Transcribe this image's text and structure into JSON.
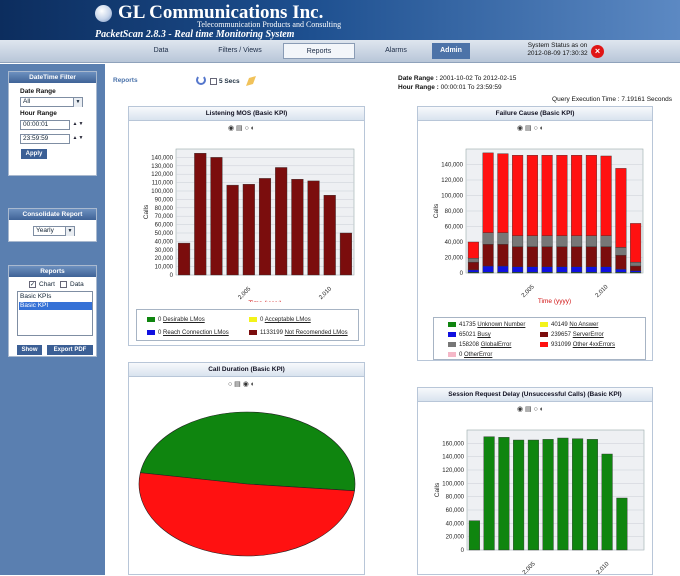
{
  "header": {
    "company": "GL Communications Inc.",
    "tagline": "Telecommunication Products and Consulting",
    "product": "PacketScan 2.8.3 - Real time Monitoring System"
  },
  "nav": {
    "items": [
      {
        "label": "Data"
      },
      {
        "label": "Filters / Views"
      },
      {
        "label": "Reports",
        "active": true
      },
      {
        "label": "Alarms"
      },
      {
        "label": "Admin",
        "admin": true
      }
    ],
    "status_label": "System Status as on",
    "status_time": "2012-08-09 17:30:32"
  },
  "sidebar": {
    "datetime_filter": {
      "title": "DateTime Filter",
      "date_range_label": "Date Range",
      "date_range_value": "All",
      "hour_range_label": "Hour Range",
      "hour_start": "00:00:01",
      "hour_end": "23:59:59",
      "apply_label": "Apply"
    },
    "consolidate": {
      "title": "Consolidate Report",
      "value": "Yearly"
    },
    "reports": {
      "title": "Reports",
      "chart_label": "Chart",
      "data_label": "Data",
      "items": [
        "Basic KPIs",
        "Basic KPI"
      ],
      "show_label": "Show",
      "export_label": "Export PDF"
    }
  },
  "toolbar": {
    "reports_label": "Reports",
    "refresh_label": "5 Secs",
    "date_range_label": "Date Range :",
    "date_range_value": "2001-10-02 To 2012-02-15",
    "hour_range_label": "Hour Range :",
    "hour_range_value": "00:00:01 To 23:59:59",
    "query_time": "Query Execution Time : 7.19161 Seconds"
  },
  "colors": {
    "maroon": "#7b0d0d",
    "red": "#ff1111",
    "grey": "#777777",
    "blue": "#1010e0",
    "green": "#0f850f",
    "yellow": "#f3f31a"
  },
  "chart_data": [
    {
      "type": "bar",
      "title": "Listening MOS (Basic KPI)",
      "xlabel": "Time (yyyy)",
      "ylabel": "Calls",
      "ylim": [
        0,
        150000
      ],
      "yticks": [
        0,
        10000,
        20000,
        30000,
        40000,
        50000,
        60000,
        70000,
        80000,
        90000,
        100000,
        110000,
        120000,
        130000,
        140000
      ],
      "ytick_labels": [
        "0",
        "10,000",
        "20,000",
        "30,000",
        "40,000",
        "50,000",
        "60,000",
        "70,000",
        "80,000",
        "90,000",
        "100,000",
        "110,000",
        "120,000",
        "130,000",
        "140,000"
      ],
      "x": [
        2001,
        2002,
        2003,
        2004,
        2005,
        2006,
        2007,
        2008,
        2009,
        2010,
        2011
      ],
      "xtick_labels": [
        "2,005",
        "2,010"
      ],
      "xtick_values": [
        2005,
        2010
      ],
      "series": [
        {
          "values": [
            38000,
            145000,
            140000,
            107000,
            108000,
            115000,
            128000,
            114000,
            112000,
            95000,
            50000
          ]
        }
      ],
      "legend": [
        {
          "value": "0",
          "label": "Desirable LMos",
          "color": "#0f850f"
        },
        {
          "value": "0",
          "label": "Acceptable LMos",
          "color": "#f3f31a"
        },
        {
          "value": "0",
          "label": "Reach Connection LMos",
          "color": "#1010e0"
        },
        {
          "value": "1133199",
          "label": "Not Recomended LMos",
          "color": "#7b0d0d"
        }
      ]
    },
    {
      "type": "bar",
      "title": "Failure Cause (Basic KPI)",
      "xlabel": "Time (yyyy)",
      "ylabel": "Calls",
      "ylim": [
        0,
        160000
      ],
      "yticks": [
        0,
        20000,
        40000,
        60000,
        80000,
        100000,
        120000,
        140000
      ],
      "ytick_labels": [
        "0",
        "20,000",
        "40,000",
        "60,000",
        "80,000",
        "100,000",
        "120,000",
        "140,000"
      ],
      "x": [
        2001,
        2002,
        2003,
        2004,
        2005,
        2006,
        2007,
        2008,
        2009,
        2010,
        2011,
        2012
      ],
      "xtick_labels": [
        "2,005",
        "2,010"
      ],
      "xtick_values": [
        2005,
        2010
      ],
      "series": [
        {
          "name": "Unknown Number",
          "color": "#0f850f",
          "values": [
            1000,
            1000,
            1000,
            1000,
            1000,
            1000,
            1000,
            1000,
            1000,
            1000,
            1000,
            1000
          ]
        },
        {
          "name": "Busy",
          "color": "#1010e0",
          "values": [
            3000,
            8000,
            8000,
            7000,
            7000,
            7000,
            7000,
            7000,
            7000,
            7000,
            4000,
            2000
          ]
        },
        {
          "name": "ServerError",
          "color": "#7b0d0d",
          "values": [
            10000,
            28000,
            28000,
            26000,
            26000,
            26000,
            26000,
            26000,
            26000,
            26000,
            18000,
            6000
          ]
        },
        {
          "name": "GlobalError",
          "color": "#777777",
          "values": [
            5000,
            15000,
            15000,
            14000,
            14000,
            14000,
            14000,
            14000,
            14000,
            14000,
            10000,
            5000
          ]
        },
        {
          "name": "Other 4xxErrors",
          "color": "#ff1111",
          "values": [
            21000,
            103000,
            102000,
            104000,
            104000,
            104000,
            104000,
            104000,
            104000,
            103000,
            102000,
            50000
          ]
        }
      ],
      "legend": [
        {
          "value": "41735",
          "label": "Unknown Number",
          "color": "#0f850f"
        },
        {
          "value": "40149",
          "label": "No Answer",
          "color": "#f3f31a"
        },
        {
          "value": "65021",
          "label": "Busy",
          "color": "#1010e0"
        },
        {
          "value": "239657",
          "label": "ServerError",
          "color": "#7b0d0d"
        },
        {
          "value": "158208",
          "label": "GlobalError",
          "color": "#777777"
        },
        {
          "value": "931099",
          "label": "Other 4xxErrors",
          "color": "#ff1111"
        },
        {
          "value": "0",
          "label": "OtherError",
          "color": "#f5b8c8"
        }
      ]
    },
    {
      "type": "pie",
      "title": "Call Duration (Basic KPI)",
      "slices": [
        {
          "color": "#0f850f",
          "value": 0.49
        },
        {
          "color": "#ff1111",
          "value": 0.51
        }
      ]
    },
    {
      "type": "bar",
      "title": "Session Request Delay (Unsuccessful Calls) (Basic KPI)",
      "ylabel": "Calls",
      "ylim": [
        0,
        180000
      ],
      "yticks": [
        0,
        20000,
        40000,
        60000,
        80000,
        100000,
        120000,
        140000,
        160000
      ],
      "ytick_labels": [
        "0",
        "20,000",
        "40,000",
        "60,000",
        "80,000",
        "100,000",
        "120,000",
        "140,000",
        "160,000"
      ],
      "x": [
        2001,
        2002,
        2003,
        2004,
        2005,
        2006,
        2007,
        2008,
        2009,
        2010,
        2011,
        2012
      ],
      "xtick_labels": [
        "2,005",
        "2,010"
      ],
      "xtick_values": [
        2005,
        2010
      ],
      "series": [
        {
          "values": [
            44000,
            170000,
            169000,
            165000,
            165000,
            166000,
            168000,
            167000,
            166000,
            144000,
            78000,
            0
          ]
        }
      ]
    }
  ]
}
